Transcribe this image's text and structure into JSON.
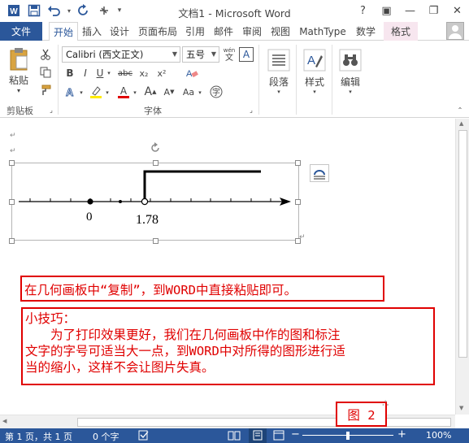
{
  "window": {
    "title": "文档1 - Microsoft Word",
    "help": "?",
    "ribbon_display": "▣",
    "minimize": "—",
    "restore": "❐",
    "close": "✕"
  },
  "tabs": [
    "文件",
    "开始",
    "插入",
    "设计",
    "页面布局",
    "引用",
    "邮件",
    "审阅",
    "视图",
    "MathType",
    "数学",
    "格式"
  ],
  "active_tab": "开始",
  "ribbon": {
    "paste_label": "粘贴",
    "clipboard_group": "剪贴板",
    "font_name": "Calibri (西文正文)",
    "font_size": "五号",
    "wen_label": "wén",
    "font_group": "字体",
    "bold": "B",
    "italic": "I",
    "underline": "U",
    "strike": "abc",
    "subscript": "x₂",
    "superscript": "x²",
    "font_color": "A",
    "grow": "A",
    "shrink": "A",
    "aa": "Aa",
    "char_a": "A",
    "paragraph_label": "段落",
    "styles_label": "样式",
    "editing_label": "编辑"
  },
  "drawing": {
    "label_zero": "0",
    "label_value": "1.78"
  },
  "notes": {
    "note1": "在几何画板中“复制”，到WORD中直接粘贴即可。",
    "note2_title": "小技巧：",
    "note2_line1": "　　为了打印效果更好，我们在几何画板中作的图和标注",
    "note2_line2": "文字的字号可适当大一点，到WORD中对所得的图形进行适",
    "note2_line3": "当的缩小，这样不会让图片失真。",
    "figure_label": "图 2"
  },
  "status": {
    "page": "第 1 页，共 1 页",
    "words": "0 个字",
    "zoom": "100%"
  },
  "colors": {
    "accent": "#2b579a",
    "annotation_red": "#e00000"
  }
}
